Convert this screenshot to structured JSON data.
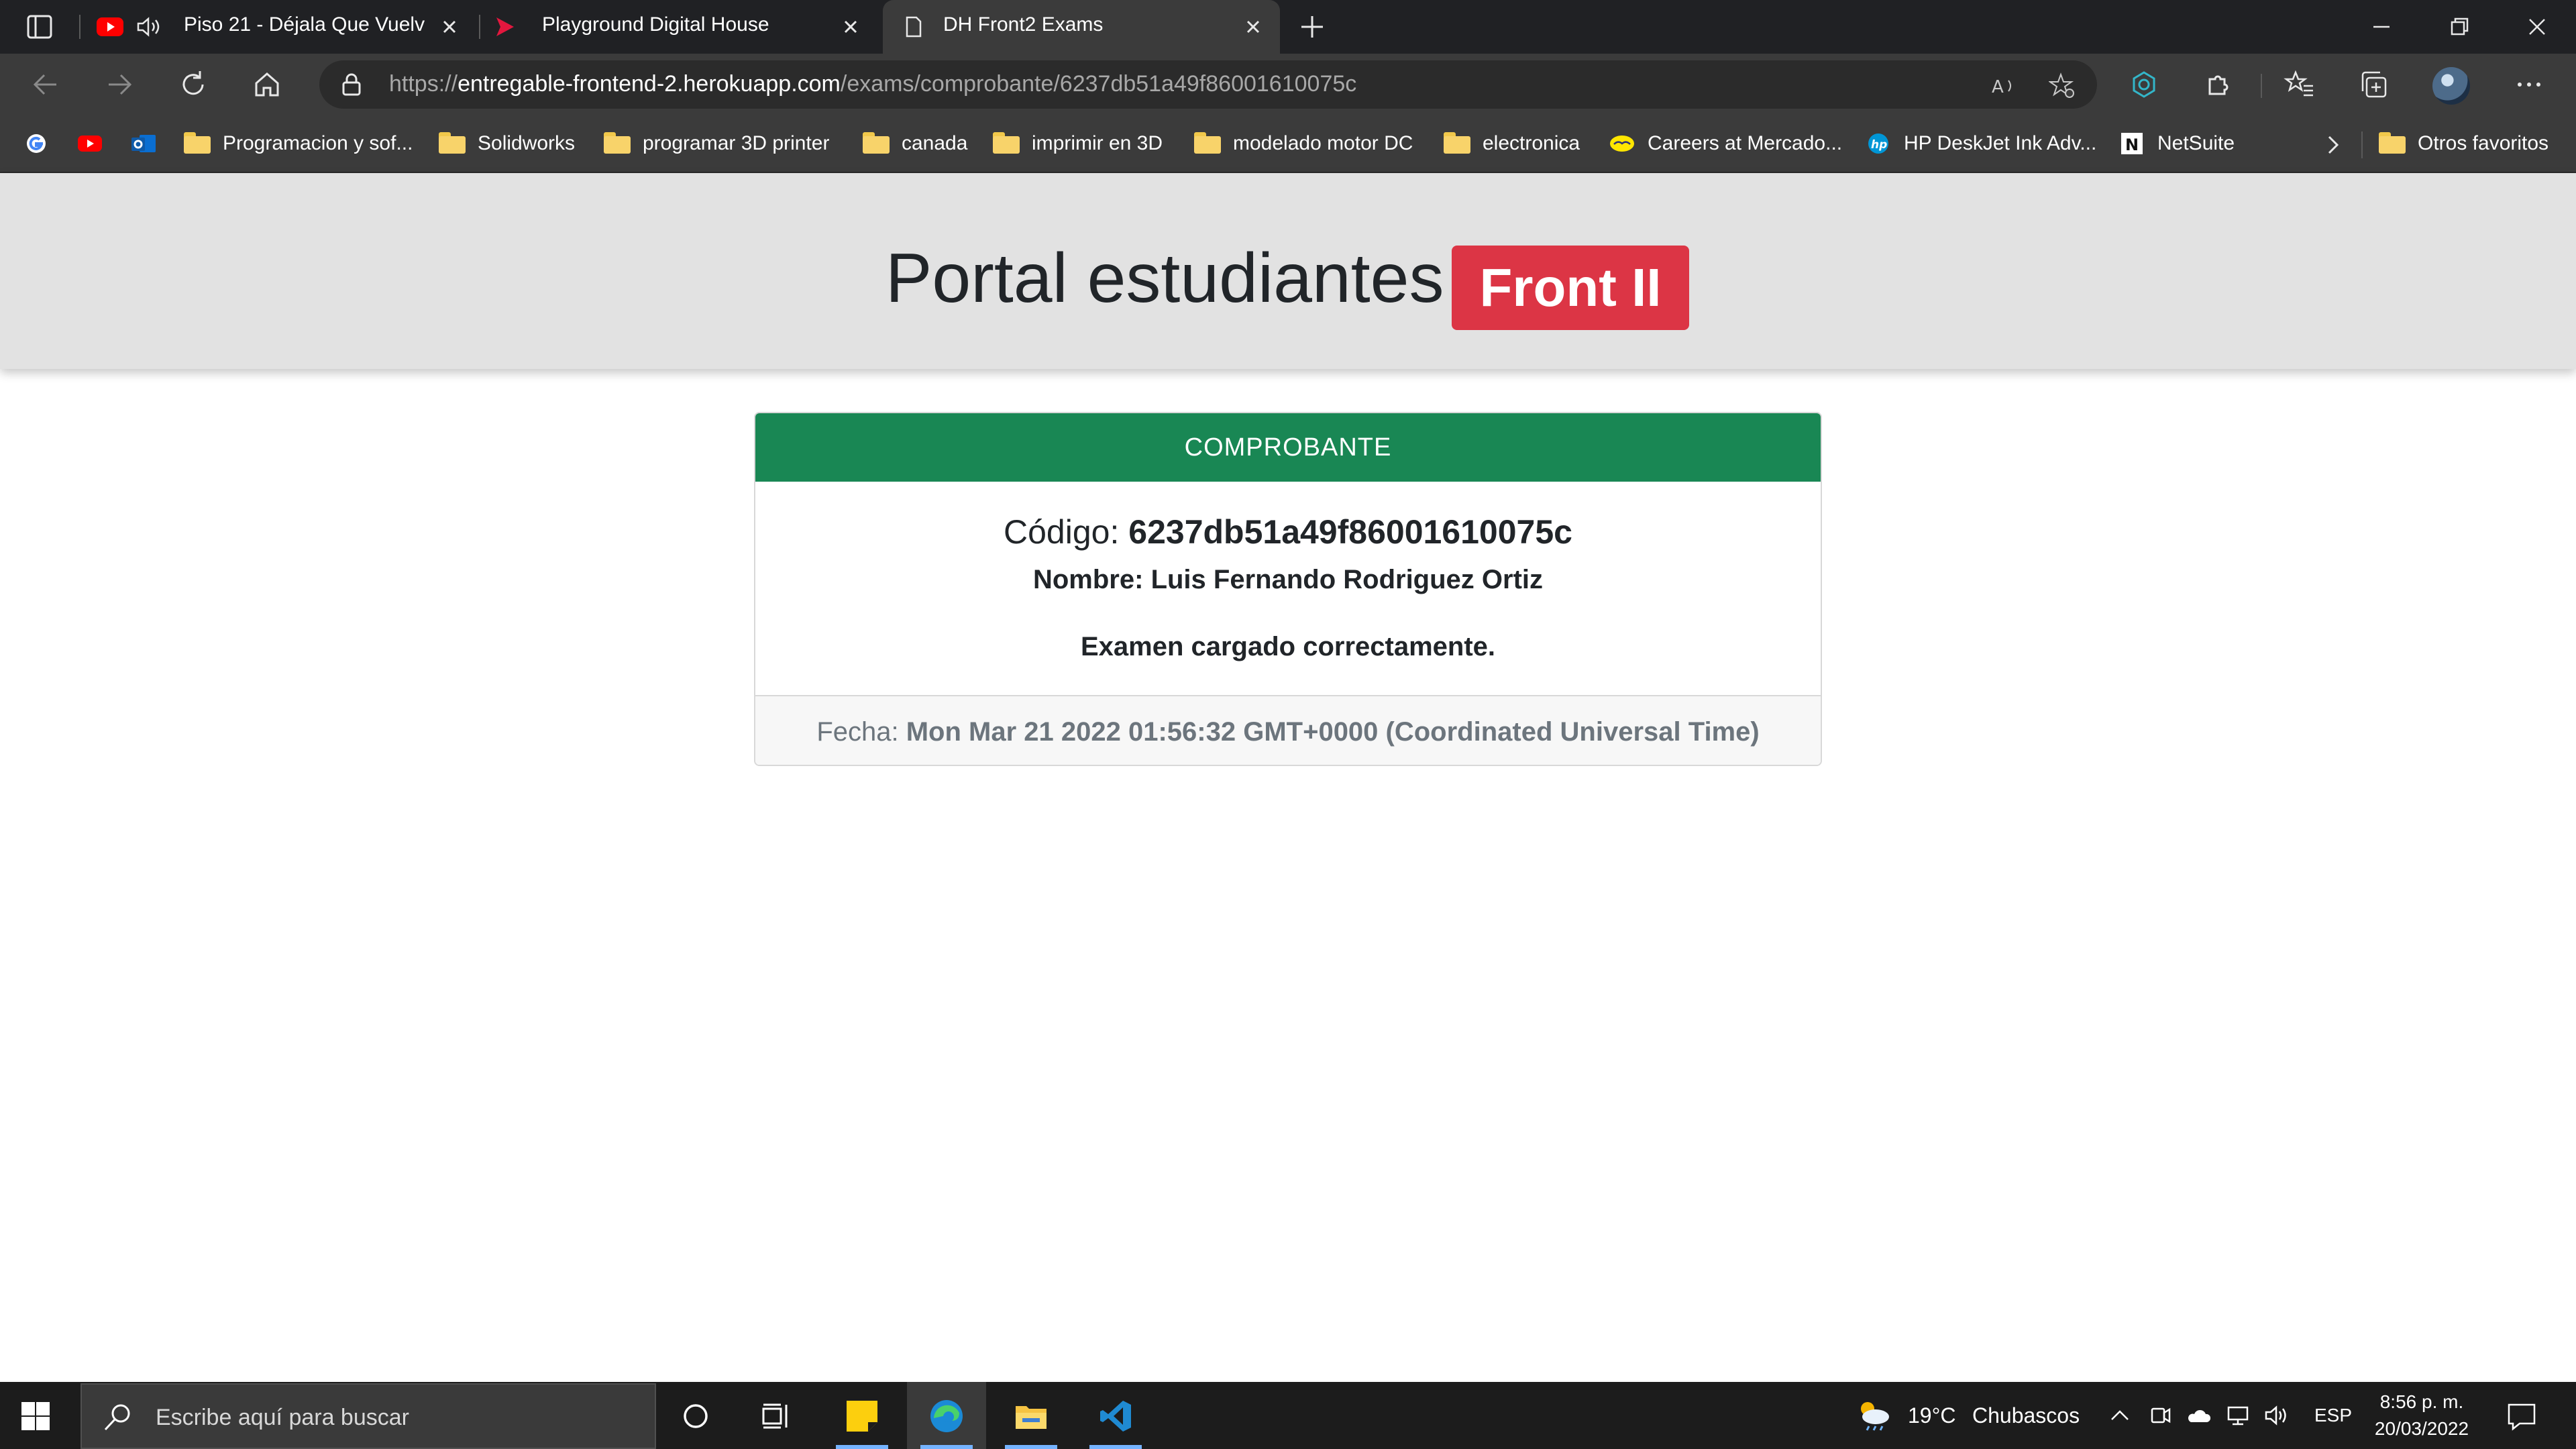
{
  "browser": {
    "tabs": [
      {
        "title": "Piso 21 - Déjala Que Vuelva",
        "favicon": "youtube-icon",
        "audio": true,
        "active": false
      },
      {
        "title": "Playground Digital House",
        "favicon": "digital-house-icon",
        "active": false
      },
      {
        "title": "DH Front2 Exams",
        "favicon": "page-icon",
        "active": true
      }
    ],
    "address": {
      "scheme": "https://",
      "host": "entregable-frontend-2.herokuapp.com",
      "path": "/exams/comprobante/6237db51a49f86001610075c"
    },
    "bookmarks": [
      {
        "label": "",
        "icon": "google-icon"
      },
      {
        "label": "",
        "icon": "youtube-icon"
      },
      {
        "label": "",
        "icon": "outlook-icon"
      },
      {
        "label": "Programacion y sof...",
        "icon": "folder-icon"
      },
      {
        "label": "Solidworks",
        "icon": "folder-icon"
      },
      {
        "label": "programar 3D printer",
        "icon": "folder-icon"
      },
      {
        "label": "canada",
        "icon": "folder-icon"
      },
      {
        "label": "imprimir en 3D",
        "icon": "folder-icon"
      },
      {
        "label": "modelado motor DC",
        "icon": "folder-icon"
      },
      {
        "label": "electronica",
        "icon": "folder-icon"
      },
      {
        "label": "Careers at Mercado...",
        "icon": "mercadolibre-icon"
      },
      {
        "label": "HP DeskJet Ink Adv...",
        "icon": "hp-icon"
      },
      {
        "label": "NetSuite",
        "icon": "netsuite-icon"
      },
      {
        "label": "Otros favoritos",
        "icon": "folder-icon"
      }
    ]
  },
  "page": {
    "header": {
      "title": "Portal estudiantes",
      "badge": "Front II"
    },
    "card": {
      "header": "COMPROBANTE",
      "codigo_label": "Código:",
      "codigo_value": "6237db51a49f86001610075c",
      "nombre_label": "Nombre:",
      "nombre_value": "Luis Fernando Rodriguez Ortiz",
      "message": "Examen cargado correctamente.",
      "fecha_label": "Fecha:",
      "fecha_value": "Mon Mar 21 2022 01:56:32 GMT+0000 (Coordinated Universal Time)"
    },
    "colors": {
      "header_band": "#e2e2e2",
      "badge": "#dc3545",
      "card_header": "#198754"
    }
  },
  "taskbar": {
    "search_placeholder": "Escribe aquí para buscar",
    "weather_temp": "19°C",
    "weather_desc": "Chubascos",
    "language": "ESP",
    "time": "8:56 p. m.",
    "date": "20/03/2022"
  }
}
